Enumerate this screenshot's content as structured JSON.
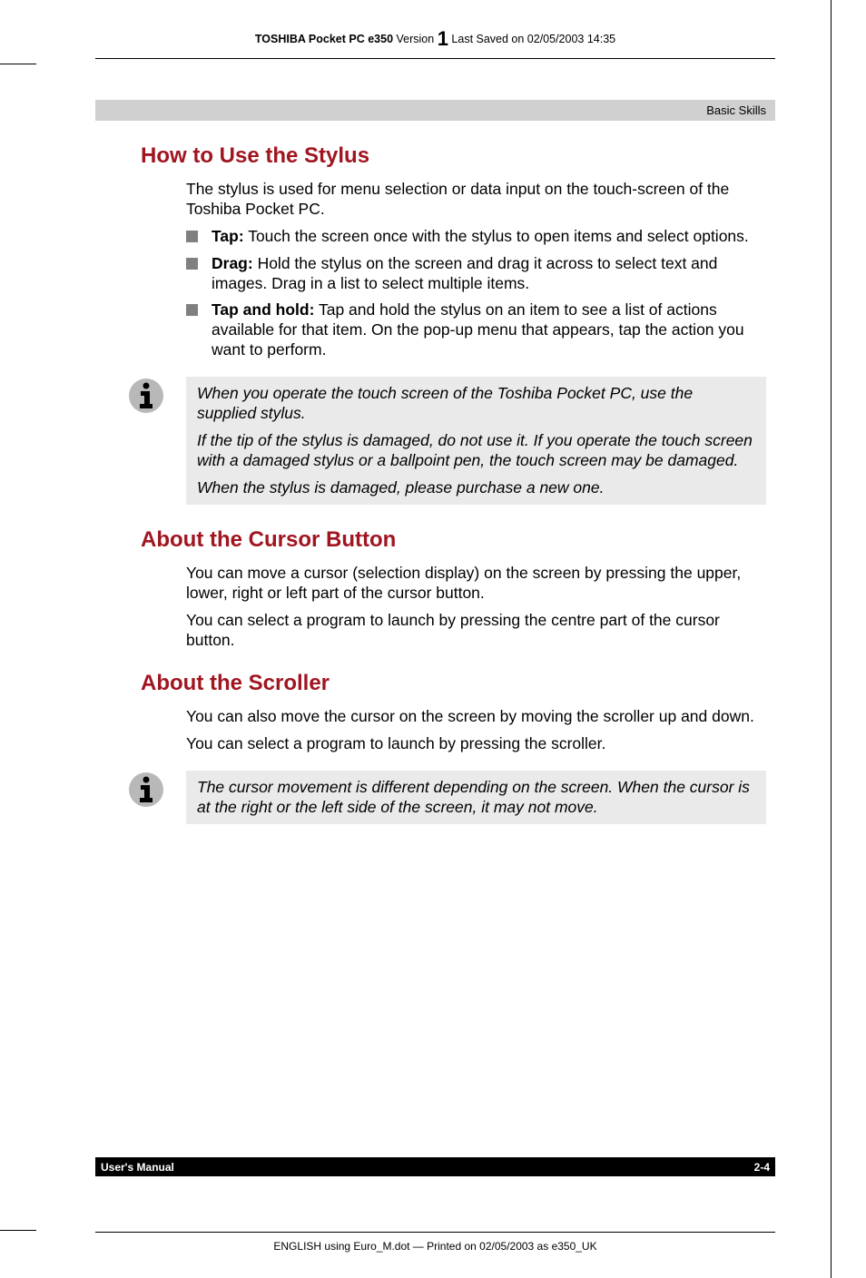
{
  "header": {
    "prefix": "TOSHIBA Pocket PC e350",
    "version_label": " Version",
    "version_num": "1",
    "suffix": " Last Saved on 02/05/2003 14:35"
  },
  "section_bar": "Basic Skills",
  "h2_stylus": "How to Use the Stylus",
  "stylus_intro": "The stylus is used for menu selection or data input on the touch-screen of the Toshiba Pocket PC.",
  "bullets": [
    {
      "bold": "Tap:",
      "text": " Touch the screen once with the stylus to open items and select options."
    },
    {
      "bold": "Drag:",
      "text": " Hold the stylus on the screen and drag it across to select text and images. Drag in a list to select multiple items."
    },
    {
      "bold": "Tap and hold:",
      "text": " Tap and hold the stylus on an item to see a list of actions available for that item. On the pop-up menu that appears, tap the action you want to perform."
    }
  ],
  "note1": [
    "When you operate the touch screen of the Toshiba Pocket PC, use the supplied stylus.",
    "If the tip of the stylus is damaged, do not use it. If you operate the touch screen with a damaged stylus or a ballpoint pen, the touch screen may be damaged.",
    "When the stylus is damaged, please purchase a new one."
  ],
  "h2_cursor": "About the Cursor Button",
  "cursor_p1": "You can move a cursor (selection display) on the screen by pressing the upper, lower, right or left part of the cursor button.",
  "cursor_p2": "You can select a program to launch by pressing the centre part of the cursor button.",
  "h2_scroller": "About the Scroller",
  "scroller_p1": "You can also move the cursor on the screen by moving the scroller up and down.",
  "scroller_p2": "You can select a program to launch by pressing the scroller.",
  "note2": [
    "The cursor movement is different depending on the screen. When the cursor is at the right or the left side of the screen, it may not move."
  ],
  "footer": {
    "left": "User's Manual",
    "right": "2-4"
  },
  "bottom_print": "ENGLISH using Euro_M.dot — Printed on 02/05/2003 as e350_UK"
}
